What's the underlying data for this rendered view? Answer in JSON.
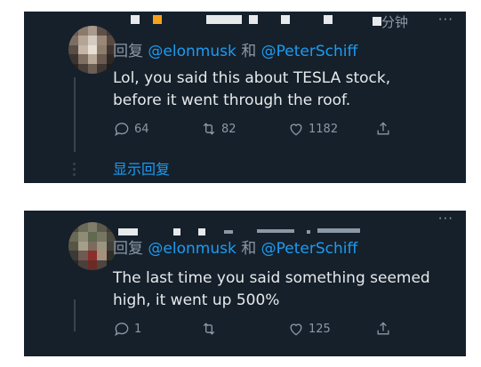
{
  "colors": {
    "background": "#15202b",
    "text": "#e7e9ea",
    "secondary": "#8b98a5",
    "accent": "#1d9bf0"
  },
  "tweets": [
    {
      "time": "分钟",
      "more": "···",
      "reply_prefix": "回复",
      "mention1": "@elonmusk",
      "connector": "和",
      "mention2": "@PeterSchiff",
      "lines": [
        "Lol, you said this about TESLA stock,",
        "before it went through the roof."
      ],
      "reply_count": "64",
      "retweet_count": "82",
      "like_count": "1182",
      "show_replies": "显示回复"
    },
    {
      "more": "···",
      "reply_prefix": "回复",
      "mention1": "@elonmusk",
      "connector": "和",
      "mention2": "@PeterSchiff",
      "lines": [
        "The last time you said something seemed",
        "high, it went up 500%"
      ],
      "reply_count": "1",
      "retweet_count": "",
      "like_count": "125"
    }
  ],
  "icons": {
    "reply": "reply-icon",
    "retweet": "retweet-icon",
    "like": "like-icon",
    "share": "share-icon"
  }
}
